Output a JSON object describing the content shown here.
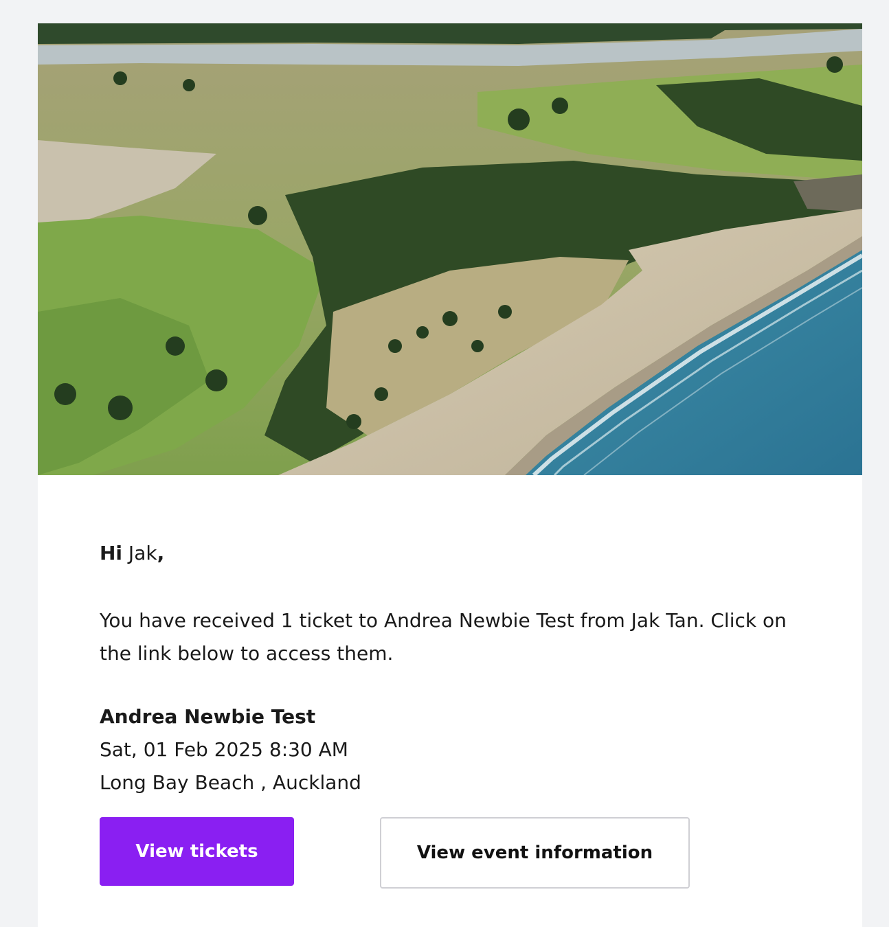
{
  "email": {
    "greeting": {
      "hi": "Hi",
      "name": " Jak",
      "comma": ","
    },
    "message": "You have received 1 ticket to Andrea Newbie Test from Jak Tan. Click on the link below to access them.",
    "event": {
      "name": "Andrea Newbie Test",
      "date": "Sat, 01 Feb 2025 8:30 AM",
      "location": "Long Bay Beach , Auckland"
    },
    "buttons": {
      "view_tickets": "View tickets",
      "view_event_information": "View event information"
    }
  },
  "colors": {
    "page_background": "#f2f3f5",
    "card_background": "#ffffff",
    "primary_button": "#8a1ff2",
    "secondary_button_border": "#cfcfd4"
  }
}
